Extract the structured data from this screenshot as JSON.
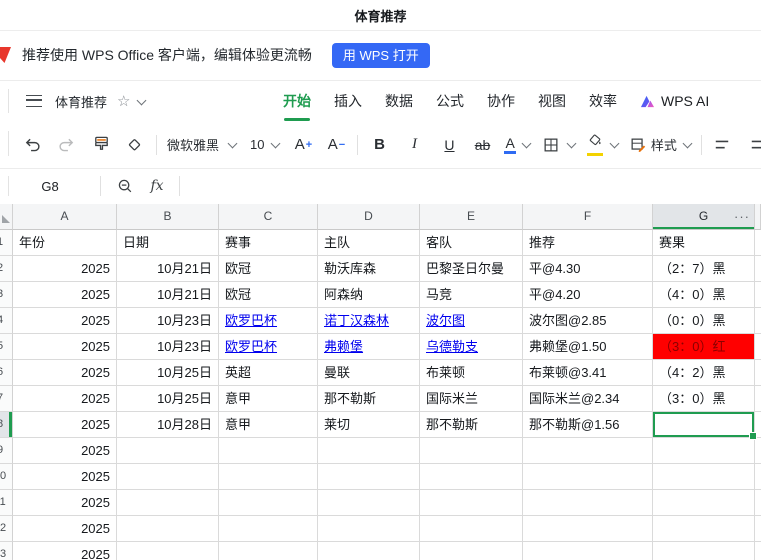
{
  "page": {
    "title": "体育推荐"
  },
  "banner": {
    "text": "推荐使用 WPS Office 客户端，编辑体验更流畅",
    "button": "用 WPS 打开"
  },
  "menubar": {
    "doc_title": "体育推荐",
    "tabs": [
      "开始",
      "插入",
      "数据",
      "公式",
      "协作",
      "视图",
      "效率"
    ],
    "active_tab": "开始",
    "wps_ai_label": "WPS AI"
  },
  "toolbar": {
    "font_name": "微软雅黑",
    "font_size": "10",
    "increase_font": "A",
    "increase_sign": "+",
    "decrease_font": "A",
    "decrease_sign": "−",
    "bold": "B",
    "italic": "I",
    "underline": "U",
    "strikethrough": "ab",
    "font_color_letter": "A",
    "style_label": "样式"
  },
  "formula_bar": {
    "cell_ref": "G8",
    "fx_label": "fx"
  },
  "sheet": {
    "column_letters": [
      "A",
      "B",
      "C",
      "D",
      "E",
      "F",
      "G"
    ],
    "more_columns_glyph": "···",
    "field_headers": [
      "年份",
      "日期",
      "赛事",
      "主队",
      "客队",
      "推荐",
      "赛果"
    ],
    "rows": [
      {
        "year": "2025",
        "date": "10月21日",
        "league": "欧冠",
        "home": "勒沃库森",
        "away": "巴黎圣日尔曼",
        "tip": "平@4.30",
        "result": "（2：7）黑",
        "result_style": "black",
        "linked": false
      },
      {
        "year": "2025",
        "date": "10月21日",
        "league": "欧冠",
        "home": "阿森纳",
        "away": "马竞",
        "tip": "平@4.20",
        "result": "（4：0）黑",
        "result_style": "black",
        "linked": false
      },
      {
        "year": "2025",
        "date": "10月23日",
        "league": "欧罗巴杯",
        "home": "诺丁汉森林",
        "away": "波尔图",
        "tip": "波尔图@2.85",
        "result": "（0：0）黑",
        "result_style": "black",
        "linked": true
      },
      {
        "year": "2025",
        "date": "10月23日",
        "league": "欧罗巴杯",
        "home": "弗赖堡",
        "away": "乌德勒支",
        "tip": "弗赖堡@1.50",
        "result": "（3：0）红",
        "result_style": "red",
        "linked": true
      },
      {
        "year": "2025",
        "date": "10月25日",
        "league": "英超",
        "home": "曼联",
        "away": "布莱顿",
        "tip": "布莱顿@3.41",
        "result": "（4：2）黑",
        "result_style": "black",
        "linked": false
      },
      {
        "year": "2025",
        "date": "10月25日",
        "league": "意甲",
        "home": "那不勒斯",
        "away": "国际米兰",
        "tip": "国际米兰@2.34",
        "result": "（3：0）黑",
        "result_style": "black",
        "linked": false
      },
      {
        "year": "2025",
        "date": "10月28日",
        "league": "意甲",
        "home": "莱切",
        "away": "那不勒斯",
        "tip": "那不勒斯@1.56",
        "result": "",
        "result_style": "selected",
        "linked": false
      }
    ],
    "extra_year_rows": [
      "2025",
      "2025",
      "2025",
      "2025",
      "2025"
    ],
    "selection": {
      "cell": "G8",
      "row": 8,
      "column": "G"
    }
  },
  "colors": {
    "accent_green": "#1f9c50",
    "link_blue": "#0000ee",
    "result_red_bg": "#ff0000",
    "result_red_text": "#8b0000",
    "open_button_blue": "#3468f5",
    "wps_logo_red": "#e8372c",
    "font_color_bar": "#2f6bf2",
    "fill_color_bar": "#f3d200"
  }
}
